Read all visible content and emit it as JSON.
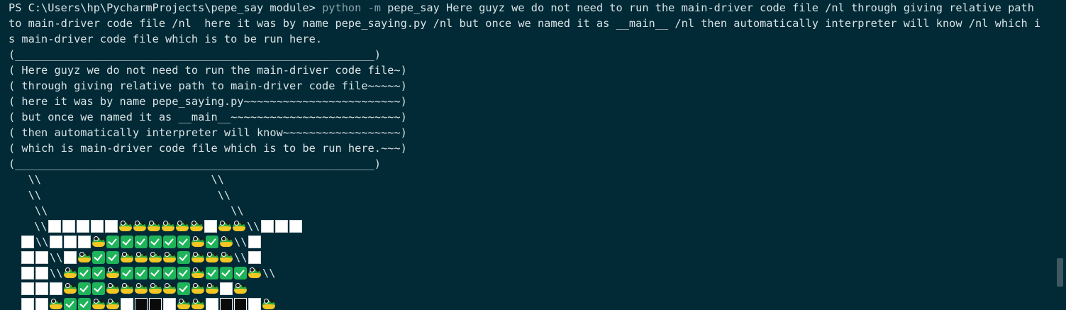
{
  "terminal": {
    "prompt": "PS C:\\Users\\hp\\PycharmProjects\\pepe_say module> ",
    "command_py": "python -m ",
    "command_args": "pepe_say Here guyz we do not need to run the main-driver code file /nl through giving relative path to main-driver code file /nl  here it was by name pepe_saying.py /nl but once we named it as __main__ /nl then automatically interpreter will know /nl which is main-driver code file which is to be run here.",
    "bubble_top": "(_______________________________________________________)",
    "bubble_lines": [
      "( Here guyz we do not need to run the main-driver code file~)",
      "( through giving relative path to main-driver code file~~~~~)",
      "( here it was by name pepe_saying.py~~~~~~~~~~~~~~~~~~~~~~~~)",
      "( but once we named it as __main__~~~~~~~~~~~~~~~~~~~~~~~~~~)",
      "( then automatically interpreter will know~~~~~~~~~~~~~~~~~~)",
      "( which is main-driver code file which is to be run here.~~~)"
    ],
    "bubble_bottom": "(_______________________________________________________)",
    "slash_lines": [
      "   \\\\                          \\\\",
      "   \\\\                           \\\\",
      "    \\\\                            \\\\"
    ]
  },
  "art": {
    "legend": {
      "w": "white-square",
      "b": "black-square",
      "g": "green-check",
      "f": "frog-face",
      "s": "double-backslash"
    },
    "rows": [
      "    s w w w w w f f f f f f w f f s w w w",
      "  w s w w w f g g g g g g f g f s w",
      "  w w s w f g g f f f f g f f f s w",
      "  w w s f g g f g g g g g f g g g f s",
      "  w w w f g g f f f f f g f f w f",
      "  w w f g g f f w b b w f f w b b w f"
    ]
  },
  "colors": {
    "background": "#012a36",
    "text": "#d9e4e6",
    "python_keyword": "#8aa4ad"
  }
}
